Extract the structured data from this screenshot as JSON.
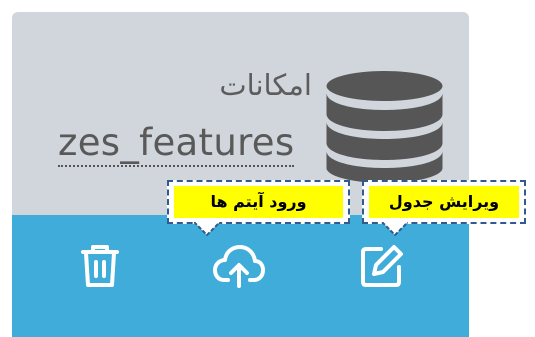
{
  "card": {
    "title": "امکانات",
    "table_name": "zes_features"
  },
  "tooltips": {
    "import_items": "ورود آیتم ها",
    "edit_table": "ویرایش جدول"
  },
  "icons": {
    "database": "database-icon",
    "delete": "trash-icon",
    "upload": "cloud-upload-icon",
    "edit": "edit-icon"
  },
  "colors": {
    "card_top": "#d1d6dc",
    "card_bottom": "#40acd9",
    "icon": "#ffffff",
    "callout_fill": "#ffff00",
    "callout_border": "#2f5b8e"
  }
}
